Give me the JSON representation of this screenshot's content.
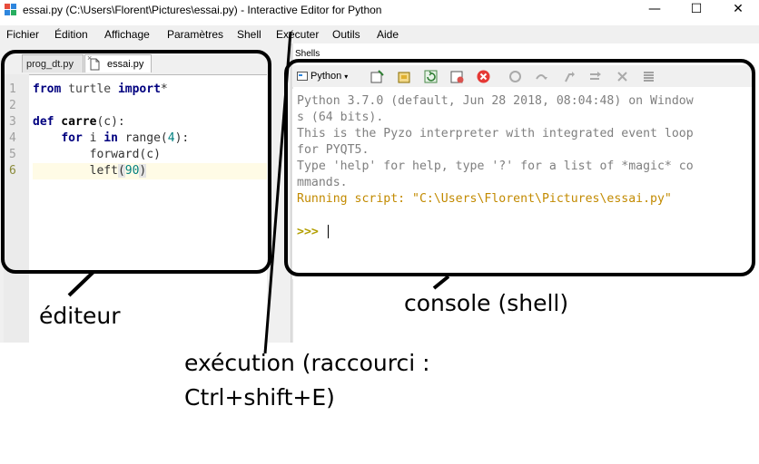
{
  "window": {
    "title": "essai.py (C:\\Users\\Florent\\Pictures\\essai.py) - Interactive Editor for Python",
    "minimize": "—",
    "maximize": "☐",
    "close": "✕"
  },
  "menu": {
    "items": [
      "Fichier",
      "Édition",
      "Affichage",
      "Paramètres",
      "Shell",
      "Exécuter",
      "Outils",
      "Aide"
    ]
  },
  "editor": {
    "tabs": [
      {
        "label": "prog_dt.py",
        "active": false
      },
      {
        "label": "essai.py",
        "active": true
      }
    ],
    "line_numbers": [
      "1",
      "2",
      "3",
      "4",
      "5",
      "6"
    ],
    "lines": {
      "l1": {
        "kw1": "from",
        "mod": " turtle ",
        "kw2": "import",
        "rest": "*"
      },
      "l3": {
        "kw": "def",
        "name": " carre",
        "rest": "(c):"
      },
      "l4": {
        "indent": "    ",
        "kw1": "for",
        "mid": " i ",
        "kw2": "in",
        "fn": " range(",
        "num": "4",
        "end": "):"
      },
      "l5": {
        "indent": "        ",
        "text": "forward(c)"
      },
      "l6": {
        "indent": "        ",
        "fn": "left",
        "open": "(",
        "num": "90",
        "close": ")"
      }
    }
  },
  "shell": {
    "panel_label": "Shells",
    "interpreter": "Python",
    "output": [
      "Python 3.7.0 (default, Jun 28 2018, 08:04:48) on Window",
      "s (64 bits).",
      "This is the Pyzo interpreter with integrated event loop",
      "for PYQT5.",
      "Type 'help' for help, type '?' for a list of *magic* co",
      "mmands."
    ],
    "running": "Running script: \"C:\\Users\\Florent\\Pictures\\essai.py\"",
    "prompt": ">>>"
  },
  "annotations": {
    "editor_label": "éditeur",
    "console_label": "console (shell)",
    "exec_line1": "exécution (raccourci :",
    "exec_line2": "Ctrl+shift+E)"
  },
  "colors": {
    "keyword": "#00007f",
    "number": "#007f7f",
    "shell_text": "#7f7f7f",
    "running_text": "#c28a00"
  }
}
